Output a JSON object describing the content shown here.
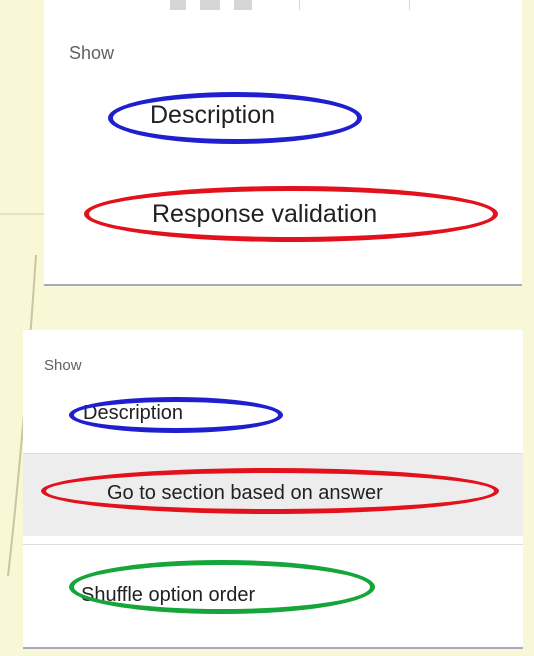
{
  "menus": [
    {
      "heading": "Show",
      "items": [
        {
          "label": "Description",
          "highlight": "blue",
          "hovered": false
        },
        {
          "label": "Response validation",
          "highlight": "red",
          "hovered": false
        }
      ]
    },
    {
      "heading": "Show",
      "items": [
        {
          "label": "Description",
          "highlight": "blue",
          "hovered": false
        },
        {
          "label": "Go to section based on answer",
          "highlight": "red",
          "hovered": true
        },
        {
          "label": "Shuffle option order",
          "highlight": "green",
          "hovered": false
        }
      ]
    }
  ],
  "colors": {
    "page_background": "#f8f7d6",
    "card_background": "#ffffff",
    "hover_background": "#ededed",
    "blue_annotation": "#1f1fd0",
    "red_annotation": "#e2111b",
    "green_annotation": "#15a53a"
  }
}
